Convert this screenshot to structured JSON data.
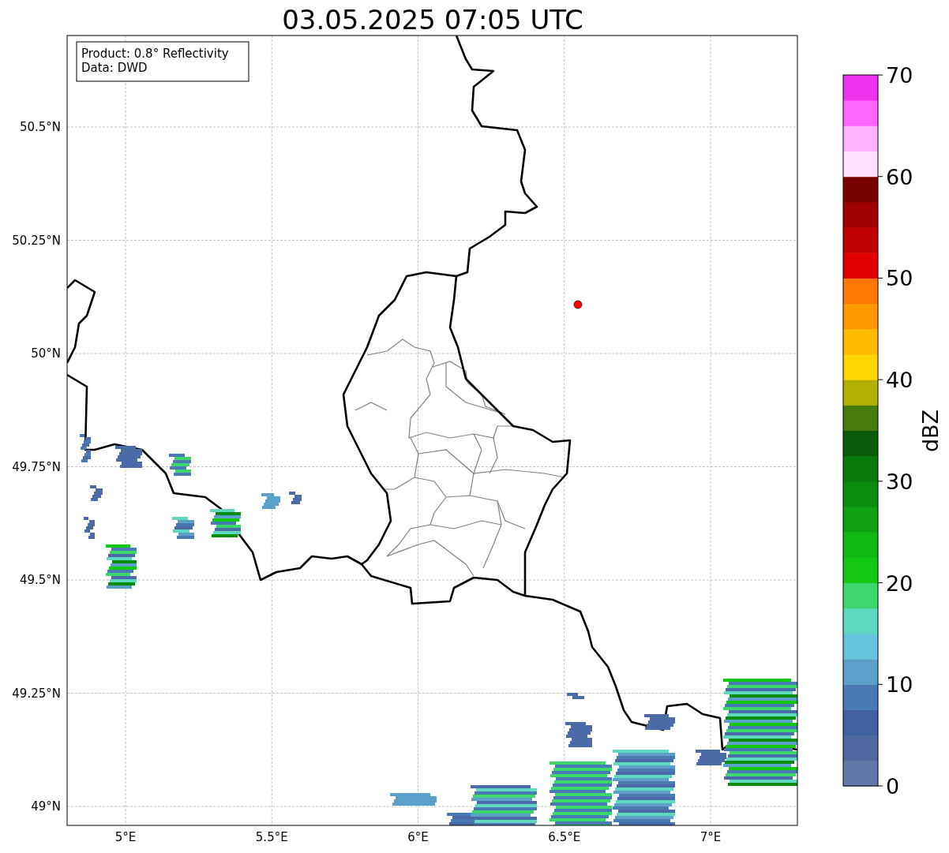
{
  "title": "03.05.2025 07:05 UTC",
  "annotation": [
    "Product: 0.8° Reflectivity",
    "Data: DWD"
  ],
  "lat_ticks": [
    "50.5°N",
    "50.25°N",
    "50°N",
    "49.75°N",
    "49.5°N",
    "49.25°N",
    "49°N"
  ],
  "lon_ticks": [
    "5°E",
    "5.5°E",
    "6°E",
    "6.5°E",
    "7°E"
  ],
  "colorbar": {
    "label": "dBZ",
    "ticks": [
      "70",
      "60",
      "50",
      "40",
      "30",
      "20",
      "10",
      "0"
    ],
    "segments": [
      {
        "color": "#6478a8"
      },
      {
        "color": "#5068a0"
      },
      {
        "color": "#4060a0"
      },
      {
        "color": "#4a7ab4"
      },
      {
        "color": "#5aa0c8"
      },
      {
        "color": "#66c4dc"
      },
      {
        "color": "#5fd8c0"
      },
      {
        "color": "#3cd66c"
      },
      {
        "color": "#12c812"
      },
      {
        "color": "#10b810"
      },
      {
        "color": "#0fa00f"
      },
      {
        "color": "#0c8c0c"
      },
      {
        "color": "#0a7a0a"
      },
      {
        "color": "#085e08"
      },
      {
        "color": "#467a0a"
      },
      {
        "color": "#b0b000"
      },
      {
        "color": "#ffd700"
      },
      {
        "color": "#ffbb00"
      },
      {
        "color": "#ff9900"
      },
      {
        "color": "#ff7700"
      },
      {
        "color": "#e00000"
      },
      {
        "color": "#c00000"
      },
      {
        "color": "#a00000"
      },
      {
        "color": "#780000"
      },
      {
        "color": "#ffe0ff"
      },
      {
        "color": "#ffb3ff"
      },
      {
        "color": "#ff66ff"
      },
      {
        "color": "#ee33ee"
      }
    ]
  }
}
